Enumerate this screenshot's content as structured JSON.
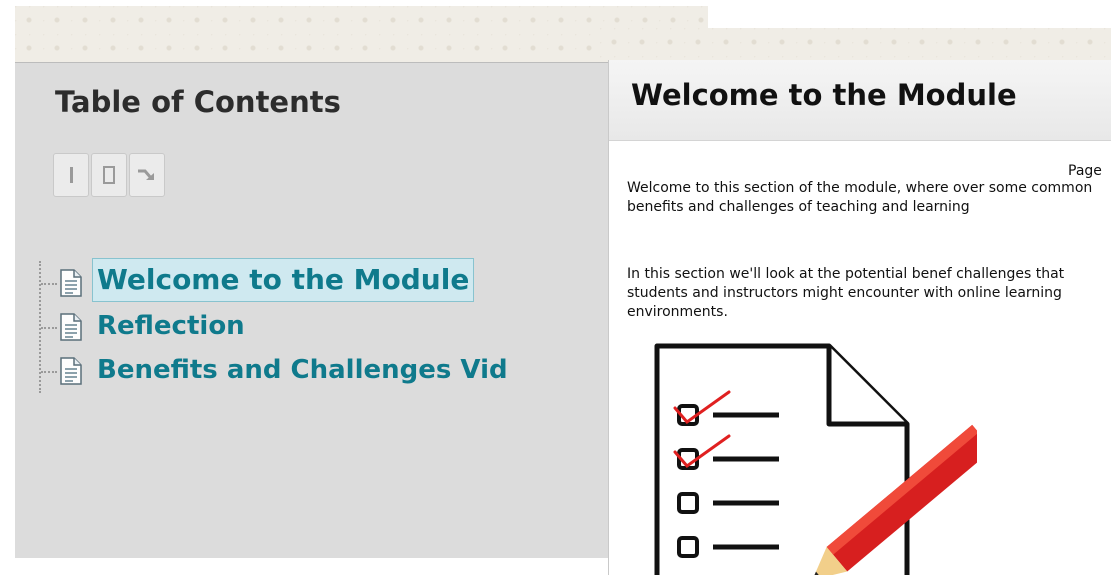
{
  "toc": {
    "title": "Table of Contents",
    "toolbar": [
      {
        "icon": "collapse-all-icon"
      },
      {
        "icon": "expand-all-icon"
      },
      {
        "icon": "arrow-down-right-icon"
      }
    ],
    "items": [
      {
        "label": "Welcome to the Module",
        "active": true,
        "icon": "page-icon"
      },
      {
        "label": "Reflection",
        "active": false,
        "icon": "page-icon"
      },
      {
        "label": "Benefits and Challenges Vid",
        "active": false,
        "icon": "page-icon"
      }
    ]
  },
  "content": {
    "title": "Welcome to the Module",
    "page_label": "Page",
    "paragraphs": [
      "Welcome to this section of the module, where over some common benefits and challenges of teaching and learning",
      "In this section we'll look at the potential benef challenges that students and instructors might encounter with online learning environments."
    ],
    "image_icon": "checklist-with-pencil-icon"
  },
  "colors": {
    "toc_link": "#0f7a8c",
    "toc_panel_bg": "#dcdcdc",
    "active_highlight": "#cfe9f0",
    "check_red": "#e02020"
  }
}
